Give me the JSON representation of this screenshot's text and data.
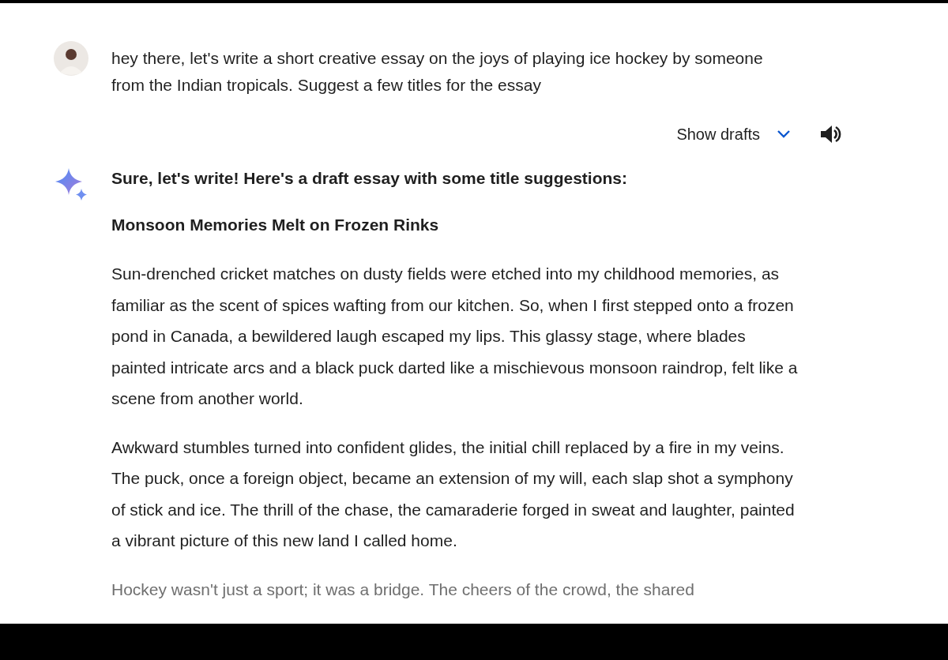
{
  "user_message": {
    "text": "hey there, let's write a short creative essay on the joys of playing ice hockey by someone from the Indian tropicals. Suggest a few titles for the essay"
  },
  "response": {
    "show_drafts": {
      "label": "Show drafts",
      "expanded": false
    },
    "heading": "Sure, let's write! Here's a draft essay with some title suggestions:",
    "title": "Monsoon Memories Melt on Frozen Rinks",
    "paragraphs": [
      {
        "text": "Sun-drenched cricket matches on dusty fields were etched into my childhood memories, as familiar as the scent of spices wafting from our kitchen. So, when I first stepped onto a frozen pond in Canada, a bewildered laugh escaped my lips. This glassy stage, where blades painted intricate arcs and a black puck darted like a mischievous monsoon raindrop, felt like a scene from another world.",
        "faded": false
      },
      {
        "text": "Awkward stumbles turned into confident glides, the initial chill replaced by a fire in my veins. The puck, once a foreign object, became an extension of my will, each slap shot a symphony of stick and ice. The thrill of the chase, the camaraderie forged in sweat and laughter, painted a vibrant picture of this new land I called home.",
        "faded": false
      },
      {
        "text": "Hockey wasn't just a sport; it was a bridge. The cheers of the crowd, the shared",
        "faded": true
      }
    ]
  }
}
